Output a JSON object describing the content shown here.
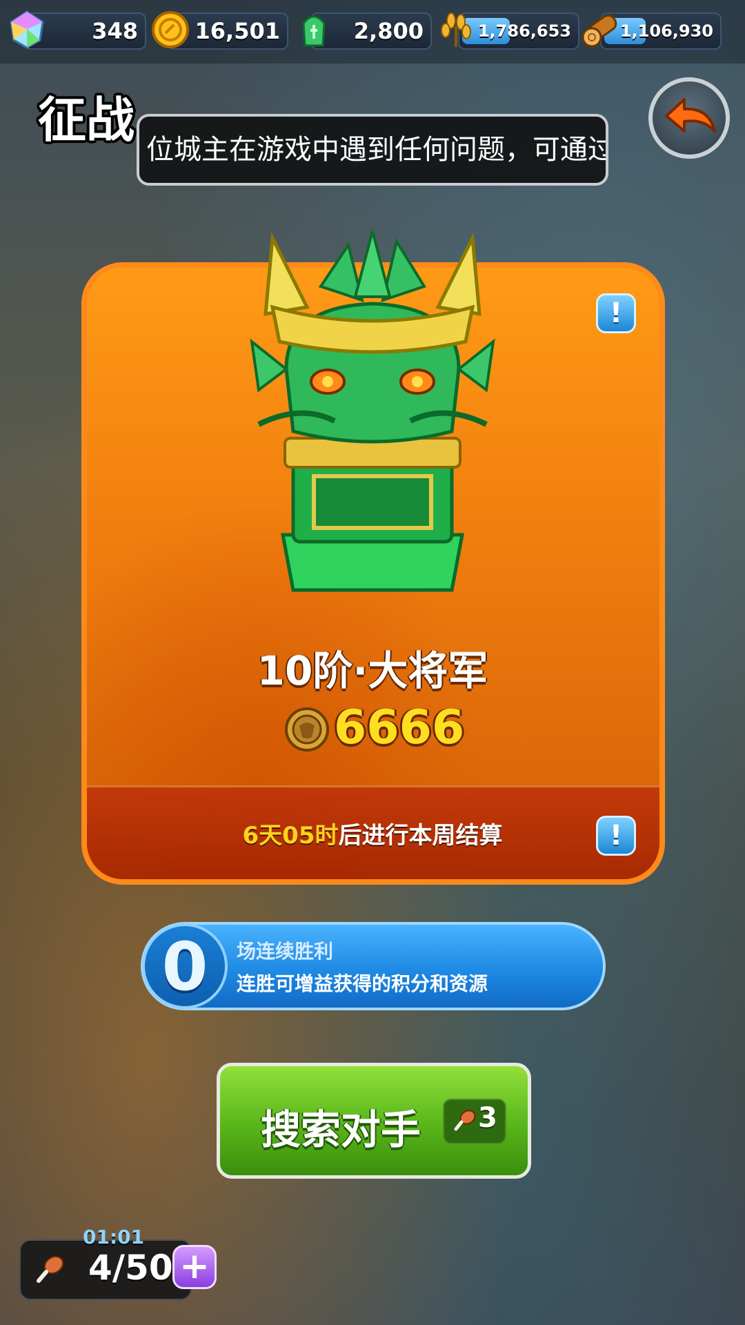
{
  "resources": [
    {
      "name": "gem",
      "value": "348",
      "icon": "gem-icon"
    },
    {
      "name": "gold",
      "value": "16,501",
      "icon": "gold-coin-icon"
    },
    {
      "name": "jade",
      "value": "2,800",
      "icon": "jade-icon"
    },
    {
      "name": "food",
      "value": "1,786,653",
      "icon": "wheat-icon",
      "fill": 0.4
    },
    {
      "name": "wood",
      "value": "1,106,930",
      "icon": "log-icon",
      "fill": 0.35
    }
  ],
  "header": {
    "title": "征战",
    "marquee": "位城主在游戏中遇到任何问题，可通过"
  },
  "rank_card": {
    "rank_name": "10阶·大将军",
    "trophies": "6666",
    "settle_highlight": "6天05时",
    "settle_text": "后进行本周结算",
    "info_symbol": "!"
  },
  "streak": {
    "count": "0",
    "line1": "场连续胜利",
    "line2": "连胜可增益获得的积分和资源"
  },
  "search": {
    "label": "搜索对手",
    "cost": "3"
  },
  "stamina": {
    "timer": "01:01",
    "value": "4/50",
    "plus": "+"
  },
  "colors": {
    "card_orange": "#ef7d0e",
    "search_green": "#58b51a",
    "streak_blue": "#1f8ae4",
    "trophy_yellow": "#ffde22"
  }
}
